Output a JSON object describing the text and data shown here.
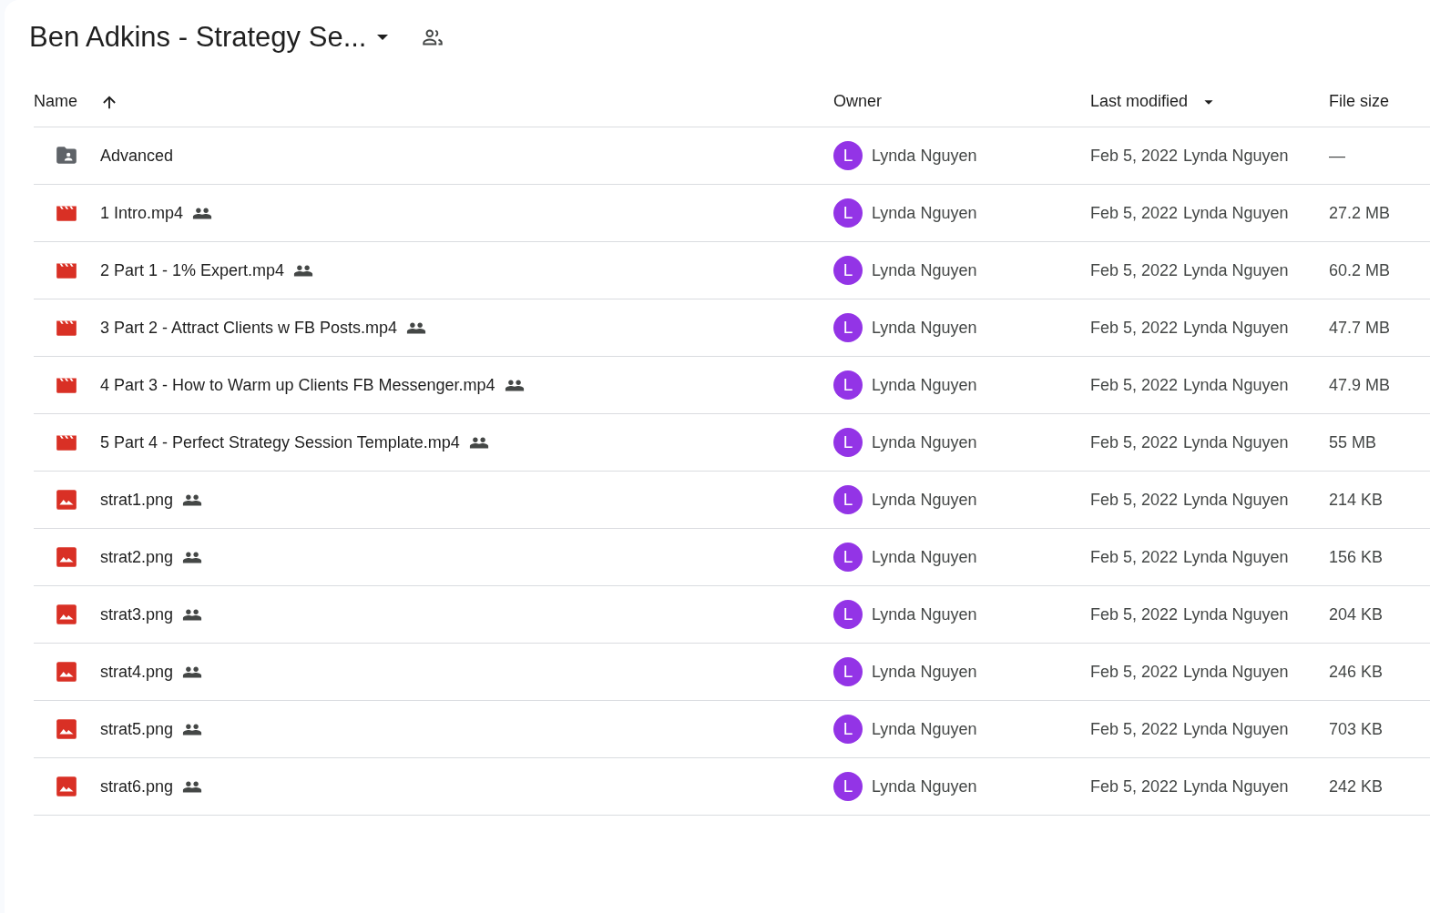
{
  "title": "Ben Adkins - Strategy Se...",
  "columns": [
    {
      "label": "Name"
    },
    {
      "label": "Owner"
    },
    {
      "label": "Last modified"
    },
    {
      "label": "File size"
    }
  ],
  "rows": [
    {
      "kind": "folder",
      "name": "Advanced",
      "shared": false,
      "owner_initial": "L",
      "color": "#9334e6",
      "owner": "Lynda Nguyen",
      "modified_date": "Feb 5, 2022",
      "modified_by": "Lynda Nguyen",
      "size": "—"
    },
    {
      "kind": "video",
      "name": "1 Intro.mp4",
      "shared": true,
      "owner_initial": "L",
      "color": "#9334e6",
      "owner": "Lynda Nguyen",
      "modified_date": "Feb 5, 2022",
      "modified_by": "Lynda Nguyen",
      "size": "27.2 MB"
    },
    {
      "kind": "video",
      "name": "2 Part 1 - 1% Expert.mp4",
      "shared": true,
      "owner_initial": "L",
      "color": "#9334e6",
      "owner": "Lynda Nguyen",
      "modified_date": "Feb 5, 2022",
      "modified_by": "Lynda Nguyen",
      "size": "60.2 MB"
    },
    {
      "kind": "video",
      "name": "3 Part 2 - Attract Clients w FB Posts.mp4",
      "shared": true,
      "owner_initial": "L",
      "color": "#9334e6",
      "owner": "Lynda Nguyen",
      "modified_date": "Feb 5, 2022",
      "modified_by": "Lynda Nguyen",
      "size": "47.7 MB"
    },
    {
      "kind": "video",
      "name": "4 Part 3 - How to Warm up Clients FB Messenger.mp4",
      "shared": true,
      "owner_initial": "L",
      "color": "#9334e6",
      "owner": "Lynda Nguyen",
      "modified_date": "Feb 5, 2022",
      "modified_by": "Lynda Nguyen",
      "size": "47.9 MB"
    },
    {
      "kind": "video",
      "name": "5 Part 4 - Perfect Strategy Session Template.mp4",
      "shared": true,
      "owner_initial": "L",
      "color": "#9334e6",
      "owner": "Lynda Nguyen",
      "modified_date": "Feb 5, 2022",
      "modified_by": "Lynda Nguyen",
      "size": "55 MB"
    },
    {
      "kind": "image",
      "name": "strat1.png",
      "shared": true,
      "owner_initial": "L",
      "color": "#9334e6",
      "owner": "Lynda Nguyen",
      "modified_date": "Feb 5, 2022",
      "modified_by": "Lynda Nguyen",
      "size": "214 KB"
    },
    {
      "kind": "image",
      "name": "strat2.png",
      "shared": true,
      "owner_initial": "L",
      "color": "#9334e6",
      "owner": "Lynda Nguyen",
      "modified_date": "Feb 5, 2022",
      "modified_by": "Lynda Nguyen",
      "size": "156 KB"
    },
    {
      "kind": "image",
      "name": "strat3.png",
      "shared": true,
      "owner_initial": "L",
      "color": "#9334e6",
      "owner": "Lynda Nguyen",
      "modified_date": "Feb 5, 2022",
      "modified_by": "Lynda Nguyen",
      "size": "204 KB"
    },
    {
      "kind": "image",
      "name": "strat4.png",
      "shared": true,
      "owner_initial": "L",
      "color": "#9334e6",
      "owner": "Lynda Nguyen",
      "modified_date": "Feb 5, 2022",
      "modified_by": "Lynda Nguyen",
      "size": "246 KB"
    },
    {
      "kind": "image",
      "name": "strat5.png",
      "shared": true,
      "owner_initial": "L",
      "color": "#9334e6",
      "owner": "Lynda Nguyen",
      "modified_date": "Feb 5, 2022",
      "modified_by": "Lynda Nguyen",
      "size": "703 KB"
    },
    {
      "kind": "image",
      "name": "strat6.png",
      "shared": true,
      "owner_initial": "L",
      "color": "#9334e6",
      "owner": "Lynda Nguyen",
      "modified_date": "Feb 5, 2022",
      "modified_by": "Lynda Nguyen",
      "size": "242 KB"
    }
  ]
}
